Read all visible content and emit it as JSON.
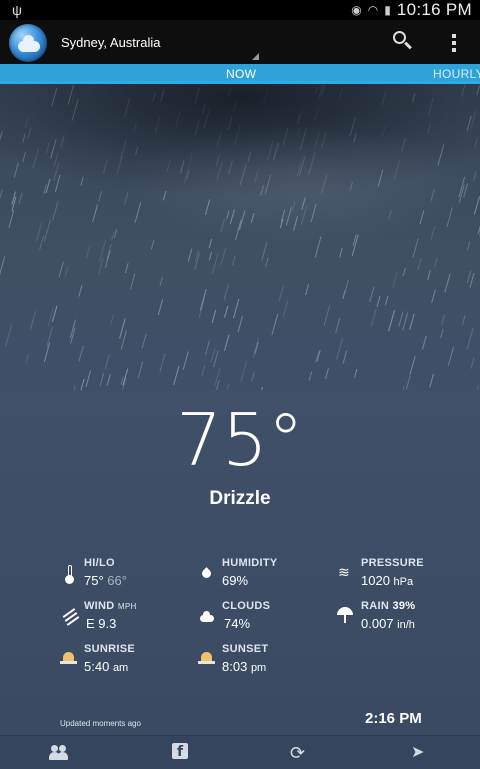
{
  "status_bar": {
    "time": "10:16 PM"
  },
  "action_bar": {
    "location": "Sydney, Australia"
  },
  "tabs": [
    {
      "label": "NOW"
    },
    {
      "label": "HOURLY"
    }
  ],
  "current": {
    "temperature": "75°",
    "condition": "Drizzle"
  },
  "stats": {
    "hilo": {
      "label": "HI/LO",
      "hi": "75°",
      "lo": "66°"
    },
    "humidity": {
      "label": "HUMIDITY",
      "value": "69%"
    },
    "pressure": {
      "label": "PRESSURE",
      "value": "1020",
      "unit": "hPa"
    },
    "wind": {
      "label": "WIND",
      "unit": "MPH",
      "value": "E 9.3"
    },
    "clouds": {
      "label": "CLOUDS",
      "value": "74%"
    },
    "rain": {
      "label": "RAIN",
      "chance": "39%",
      "value": "0.007",
      "unit": "in/h"
    },
    "sunrise": {
      "label": "SUNRISE",
      "value": "5:40",
      "suffix": "am"
    },
    "sunset": {
      "label": "SUNSET",
      "value": "8:03",
      "suffix": "pm"
    }
  },
  "footer": {
    "updated": "Updated moments ago",
    "local_time": "2:16 PM"
  },
  "icons": {
    "status": [
      "usb-icon",
      "eye-icon",
      "wifi-icon",
      "battery-icon"
    ],
    "bottom": [
      "friends-icon",
      "facebook-icon",
      "refresh-icon",
      "navigation-icon"
    ]
  }
}
